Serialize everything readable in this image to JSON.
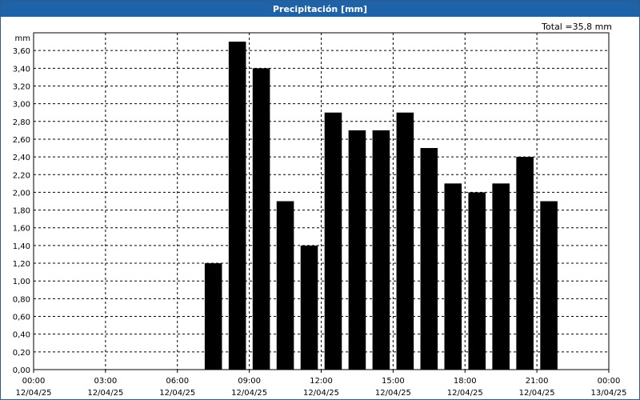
{
  "title": "Precipitación [mm]",
  "total_label": "Total =35,8 mm",
  "chart_data": {
    "type": "bar",
    "title": "Precipitación [mm]",
    "ylabel": "mm",
    "xlabel": "",
    "ylim": [
      0,
      3.8
    ],
    "grid": true,
    "y_ticks": [
      "0,00",
      "0,20",
      "0,40",
      "0,60",
      "0,80",
      "1,00",
      "1,20",
      "1,40",
      "1,60",
      "1,80",
      "2,00",
      "2,20",
      "2,40",
      "2,60",
      "2,80",
      "3,00",
      "3,20",
      "3,40",
      "3,60"
    ],
    "x_ticks": [
      {
        "time": "00:00",
        "date": "12/04/25"
      },
      {
        "time": "03:00",
        "date": "12/04/25"
      },
      {
        "time": "06:00",
        "date": "12/04/25"
      },
      {
        "time": "09:00",
        "date": "12/04/25"
      },
      {
        "time": "12:00",
        "date": "12/04/25"
      },
      {
        "time": "15:00",
        "date": "12/04/25"
      },
      {
        "time": "18:00",
        "date": "12/04/25"
      },
      {
        "time": "21:00",
        "date": "12/04/25"
      },
      {
        "time": "00:00",
        "date": "13/04/25"
      }
    ],
    "bar_color": "#000000",
    "series": [
      {
        "x_hours": [
          8,
          9,
          10,
          11,
          12,
          13,
          14,
          15,
          16,
          17,
          18,
          19,
          20,
          21,
          22
        ],
        "values": [
          1.2,
          3.7,
          3.4,
          1.9,
          1.4,
          2.9,
          2.7,
          2.7,
          2.9,
          2.5,
          2.1,
          2.0,
          2.1,
          2.4,
          1.9
        ]
      }
    ]
  }
}
